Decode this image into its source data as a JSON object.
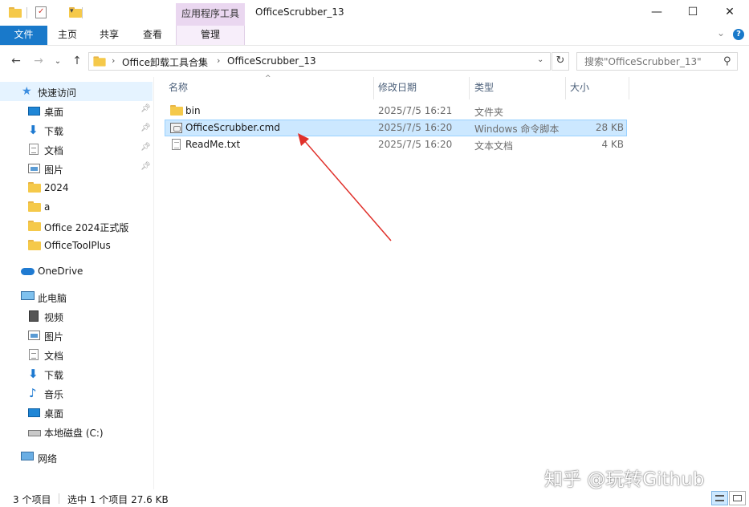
{
  "window": {
    "title": "OfficeScrubber_13",
    "contextual_tab": "应用程序工具",
    "minimize_label": "—",
    "maximize_label": "☐",
    "close_label": "✕"
  },
  "ribbon": {
    "file_tab": "文件",
    "tabs": [
      "主页",
      "共享",
      "查看"
    ],
    "manage_tab": "管理",
    "expand_glyph": "⌄",
    "help_glyph": "?"
  },
  "address": {
    "back_glyph": "←",
    "forward_glyph": "→",
    "recent_glyph": "⌄",
    "up_glyph": "↑",
    "crumbs": [
      "Office卸载工具合集",
      "OfficeScrubber_13"
    ],
    "crumb_separator": "›",
    "dropdown_glyph": "⌄",
    "refresh_glyph": "↻",
    "search_placeholder": "搜索\"OfficeScrubber_13\"",
    "search_icon": "search-icon"
  },
  "nav_pane": {
    "quick_access": "快速访问",
    "quick_items": [
      {
        "label": "桌面",
        "pinned": true
      },
      {
        "label": "下载",
        "pinned": true
      },
      {
        "label": "文档",
        "pinned": true
      },
      {
        "label": "图片",
        "pinned": true
      },
      {
        "label": "2024",
        "pinned": false
      },
      {
        "label": "a",
        "pinned": false
      },
      {
        "label": "Office 2024正式版",
        "pinned": false
      },
      {
        "label": "OfficeToolPlus",
        "pinned": false
      }
    ],
    "onedrive": "OneDrive",
    "this_pc": "此电脑",
    "pc_items": [
      "视频",
      "图片",
      "文档",
      "下载",
      "音乐",
      "桌面",
      "本地磁盘 (C:)"
    ],
    "network": "网络"
  },
  "file_list": {
    "columns": [
      "名称",
      "修改日期",
      "类型",
      "大小"
    ],
    "sort_glyph": "^",
    "rows": [
      {
        "name": "bin",
        "date": "2025/7/5 16:21",
        "type": "文件夹",
        "size": "",
        "icon": "folder-icon",
        "selected": false
      },
      {
        "name": "OfficeScrubber.cmd",
        "date": "2025/7/5 16:20",
        "type": "Windows 命令脚本",
        "size": "28 KB",
        "icon": "cmd-file-icon",
        "selected": true
      },
      {
        "name": "ReadMe.txt",
        "date": "2025/7/5 16:20",
        "type": "文本文档",
        "size": "4 KB",
        "icon": "text-file-icon",
        "selected": false
      }
    ]
  },
  "annotation": {
    "arrow_color": "#e0302a"
  },
  "watermark": "知乎 @玩转Github",
  "status": {
    "item_count": "3 个项目",
    "selection": "选中 1 个项目  27.6 KB"
  },
  "colors": {
    "accent": "#1979ca",
    "selection": "#cce8ff",
    "context_tab": "#ead7f0"
  }
}
